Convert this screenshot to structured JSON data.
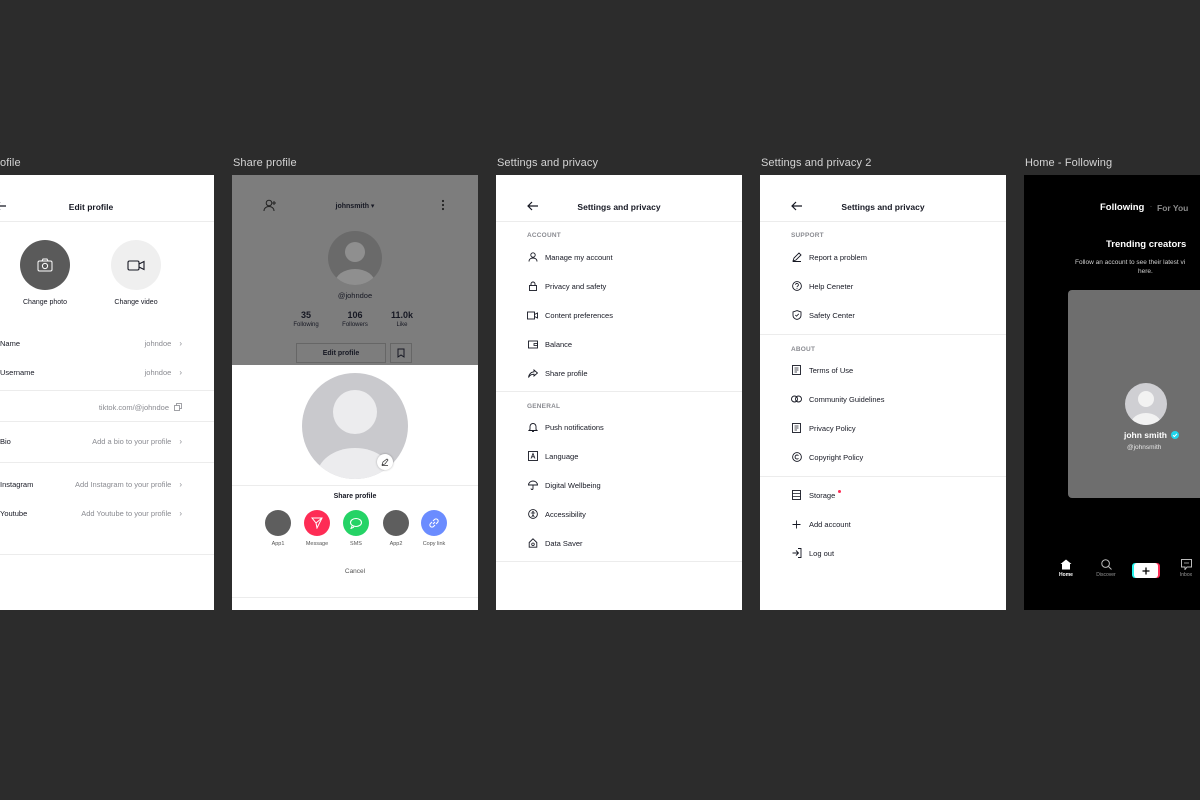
{
  "frames": {
    "edit_profile": {
      "label": "ofile",
      "title": "Edit profile",
      "change_photo": "Change photo",
      "change_video": "Change video",
      "rows": {
        "name": {
          "label": "Name",
          "value": "johndoe"
        },
        "username": {
          "label": "Username",
          "value": "johndoe"
        },
        "link": {
          "value": "tiktok.com/@johndoe"
        },
        "bio": {
          "label": "Bio",
          "value": "Add a bio to your profile"
        },
        "instagram": {
          "label": "Instagram",
          "value": "Add Instagram to your profile"
        },
        "youtube": {
          "label": "Youtube",
          "value": "Add Youtube to your profile"
        }
      }
    },
    "share_profile": {
      "label": "Share profile",
      "username_top": "johnsmith",
      "handle": "@johndoe",
      "stats": [
        {
          "value": "35",
          "label": "Following"
        },
        {
          "value": "106",
          "label": "Followers"
        },
        {
          "value": "11.0k",
          "label": "Like"
        }
      ],
      "edit_button": "Edit profile",
      "sheet_title": "Share profile",
      "apps": [
        {
          "name": "App1",
          "color": "#5e5e5e"
        },
        {
          "name": "Message",
          "color": "#fe2c55"
        },
        {
          "name": "SMS",
          "color": "#25d366"
        },
        {
          "name": "App2",
          "color": "#5e5e5e"
        },
        {
          "name": "Copy link",
          "color": "#6b8cff"
        }
      ],
      "cancel": "Cancel"
    },
    "settings1": {
      "label": "Settings and privacy",
      "title": "Settings and privacy",
      "account_header": "ACCOUNT",
      "account_items": [
        "Manage my account",
        "Privacy and safety",
        "Content preferences",
        "Balance",
        "Share profile"
      ],
      "general_header": "GENERAL",
      "general_items": [
        "Push notifications",
        "Language",
        "Digital Wellbeing",
        "Accessibility",
        "Data Saver"
      ]
    },
    "settings2": {
      "label": "Settings and privacy 2",
      "title": "Settings and privacy",
      "support_header": "SUPPORT",
      "support_items": [
        "Report a problem",
        "Help Ceneter",
        "Safety Center"
      ],
      "about_header": "ABOUT",
      "about_items": [
        "Terms of Use",
        "Community Guidelines",
        "Privacy Policy",
        "Copyright Policy"
      ],
      "other_items": [
        "Storage",
        "Add account",
        "Log out"
      ]
    },
    "home_following": {
      "label": "Home - Following",
      "tab_following": "Following",
      "tab_foryou": "For You",
      "trending_title": "Trending creators",
      "trending_sub_1": "Follow an account to see their latest vi",
      "trending_sub_2": "here.",
      "creator_name": "john smith",
      "creator_handle": "@johnsmith",
      "nav": [
        "Home",
        "Discover",
        "Inbox"
      ]
    }
  },
  "colors": {
    "background": "#2c2c2c",
    "accent_red": "#fe2c55",
    "accent_cyan": "#25f4ee"
  }
}
